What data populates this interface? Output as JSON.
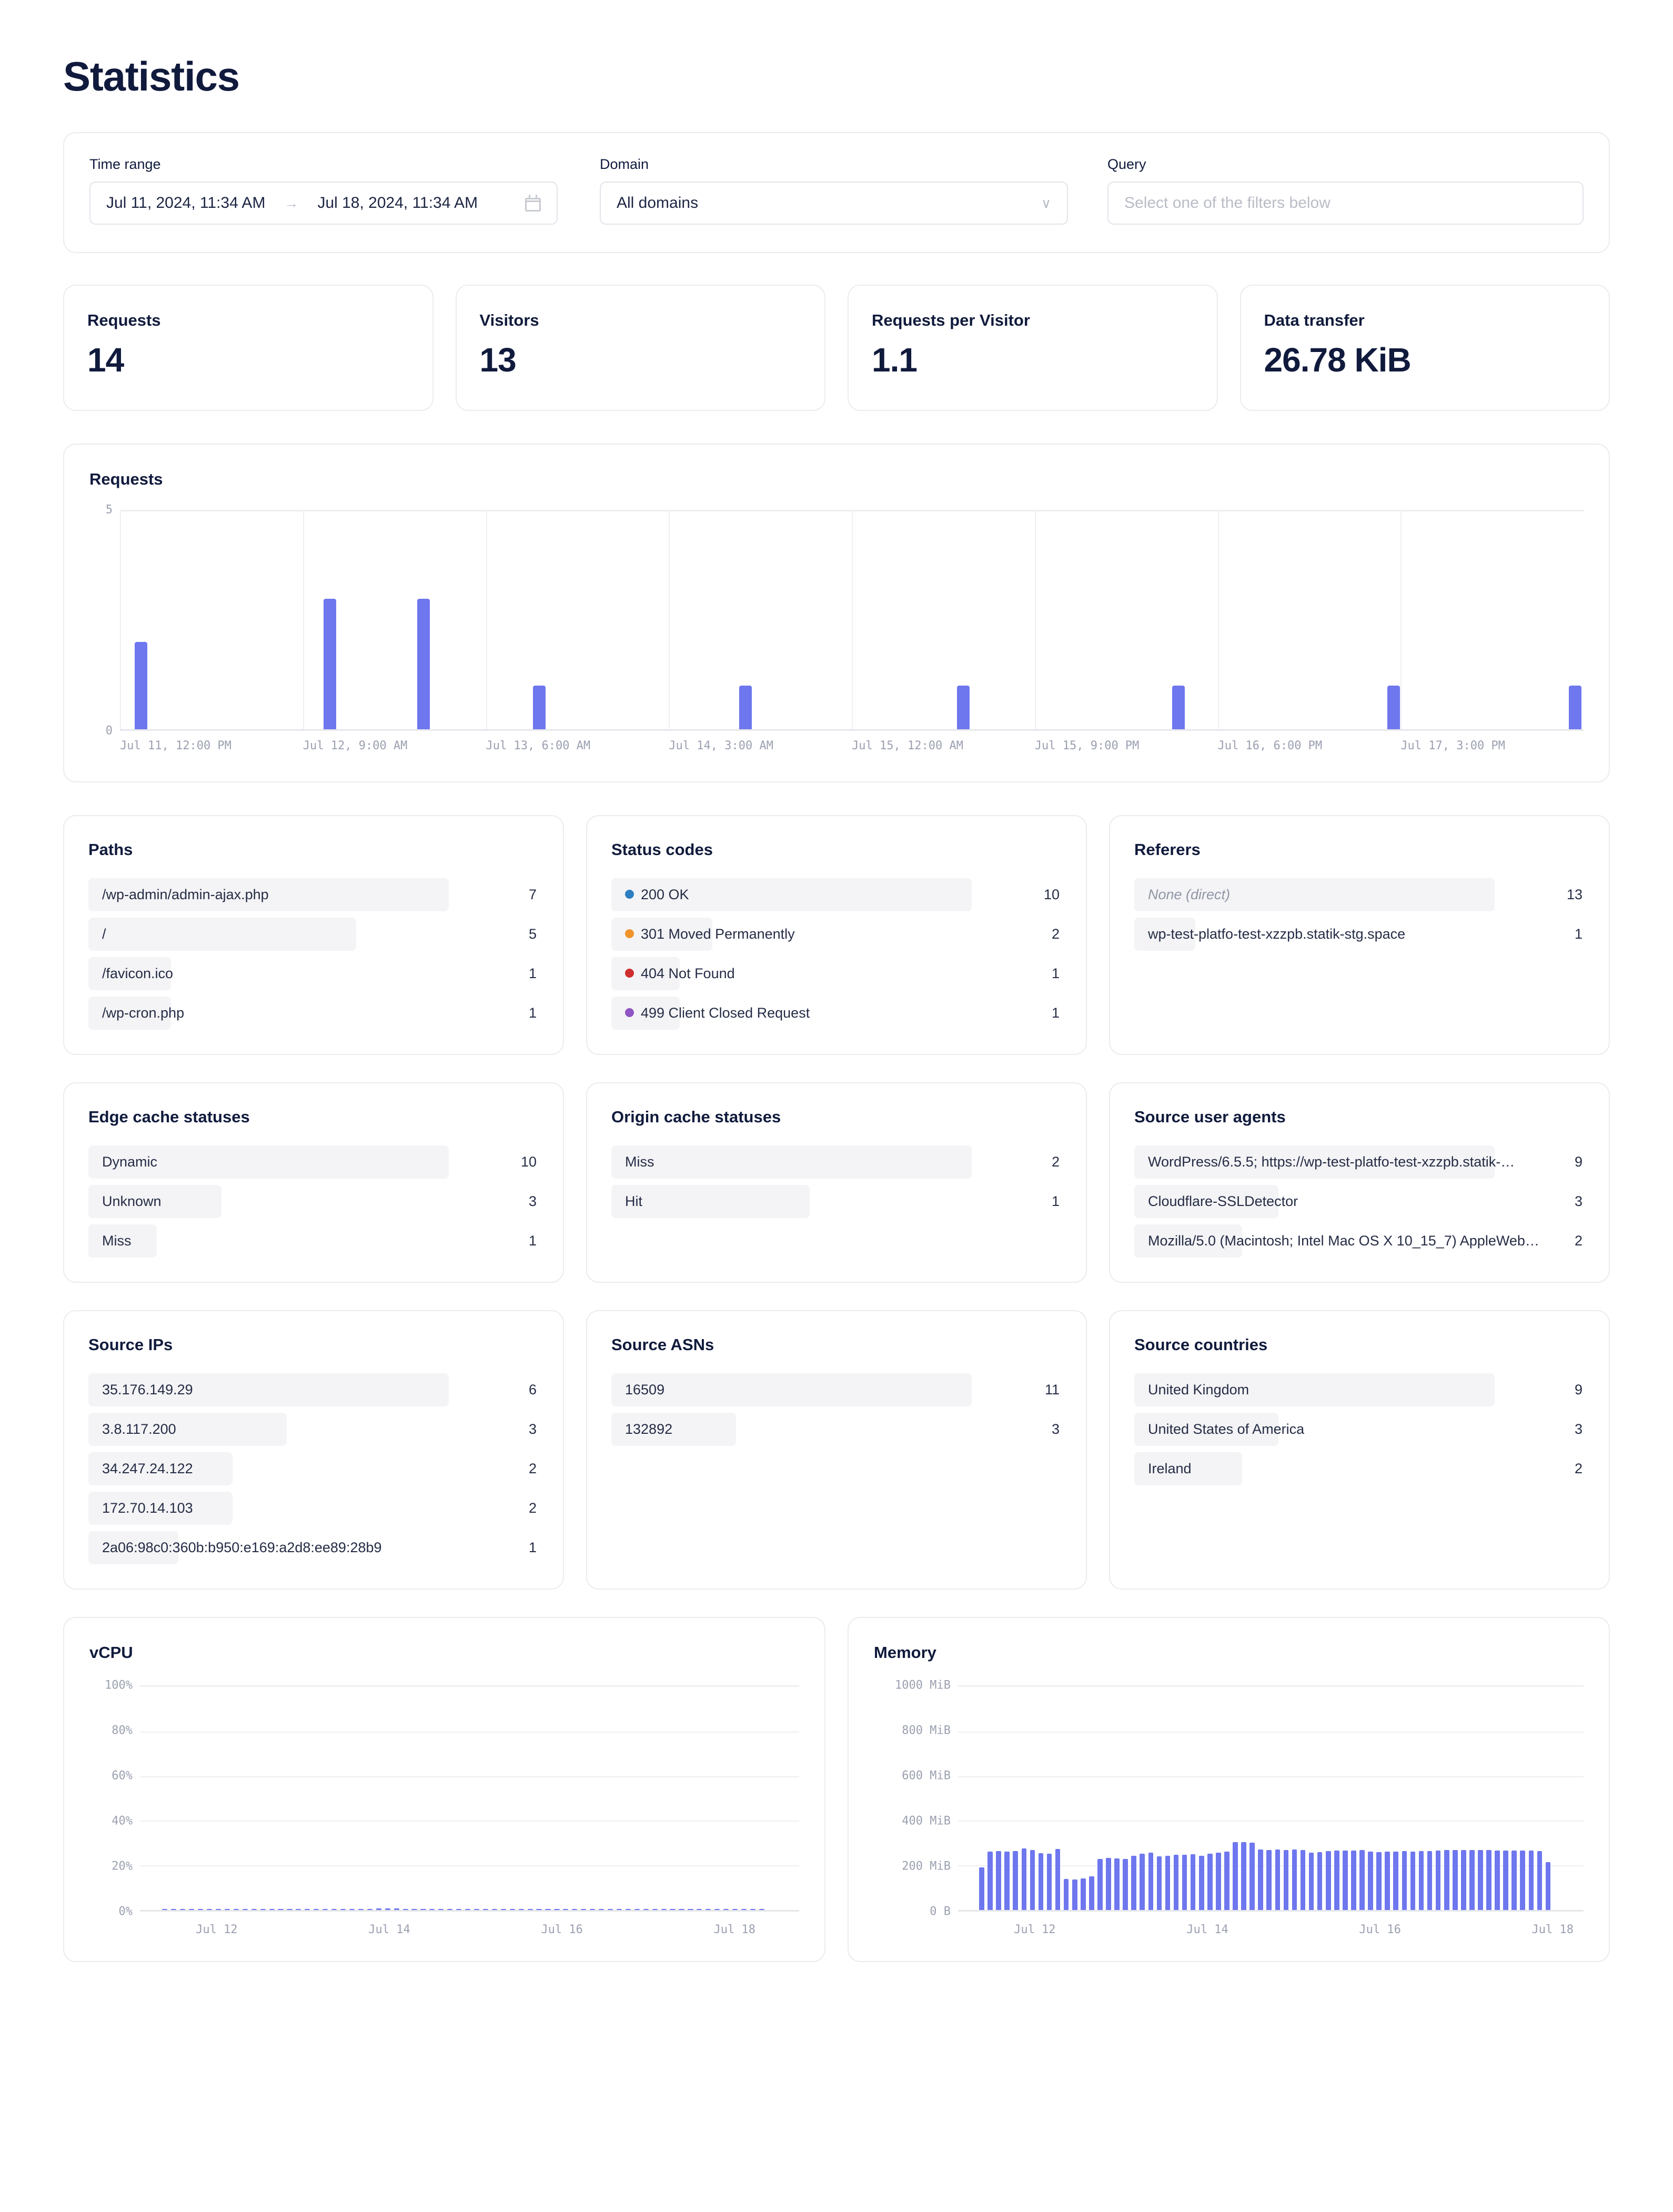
{
  "page": {
    "title": "Statistics"
  },
  "filters": {
    "time_range": {
      "label": "Time range",
      "start": "Jul 11, 2024, 11:34 AM",
      "end": "Jul 18, 2024, 11:34 AM",
      "arrow": "→"
    },
    "domain": {
      "label": "Domain",
      "value": "All domains",
      "chevron": "∨"
    },
    "query": {
      "label": "Query",
      "value": "",
      "placeholder": "Select one of the filters below"
    }
  },
  "kpis": [
    {
      "label": "Requests",
      "value": "14"
    },
    {
      "label": "Visitors",
      "value": "13"
    },
    {
      "label": "Requests per Visitor",
      "value": "1.1"
    },
    {
      "label": "Data transfer",
      "value": "26.78 KiB"
    }
  ],
  "requests_chart": {
    "title": "Requests"
  },
  "panels": {
    "paths": {
      "title": "Paths",
      "rows": [
        {
          "label": "/wp-admin/admin-ajax.php",
          "count": "7"
        },
        {
          "label": "/",
          "count": "5"
        },
        {
          "label": "/favicon.ico",
          "count": "1"
        },
        {
          "label": "/wp-cron.php",
          "count": "1"
        }
      ]
    },
    "status_codes": {
      "title": "Status codes",
      "rows": [
        {
          "label": "200 OK",
          "count": "10",
          "color": "#2d7fc1"
        },
        {
          "label": "301 Moved Permanently",
          "count": "2",
          "color": "#f0932b"
        },
        {
          "label": "404 Not Found",
          "count": "1",
          "color": "#cf2e2e"
        },
        {
          "label": "499 Client Closed Request",
          "count": "1",
          "color": "#8e55c4"
        }
      ]
    },
    "referers": {
      "title": "Referers",
      "rows": [
        {
          "label": "None (direct)",
          "count": "13",
          "muted": true
        },
        {
          "label": "wp-test-platfo-test-xzzpb.statik-stg.space",
          "count": "1"
        }
      ]
    },
    "edge_cache": {
      "title": "Edge cache statuses",
      "rows": [
        {
          "label": "Dynamic",
          "count": "10"
        },
        {
          "label": "Unknown",
          "count": "3"
        },
        {
          "label": "Miss",
          "count": "1"
        }
      ]
    },
    "origin_cache": {
      "title": "Origin cache statuses",
      "rows": [
        {
          "label": "Miss",
          "count": "2"
        },
        {
          "label": "Hit",
          "count": "1"
        }
      ]
    },
    "user_agents": {
      "title": "Source user agents",
      "rows": [
        {
          "label": "WordPress/6.5.5; https://wp-test-platfo-test-xzzpb.statik-…",
          "count": "9"
        },
        {
          "label": "Cloudflare-SSLDetector",
          "count": "3"
        },
        {
          "label": "Mozilla/5.0 (Macintosh; Intel Mac OS X 10_15_7) AppleWeb…",
          "count": "2"
        }
      ]
    },
    "source_ips": {
      "title": "Source IPs",
      "rows": [
        {
          "label": "35.176.149.29",
          "count": "6"
        },
        {
          "label": "3.8.117.200",
          "count": "3"
        },
        {
          "label": "34.247.24.122",
          "count": "2"
        },
        {
          "label": "172.70.14.103",
          "count": "2"
        },
        {
          "label": "2a06:98c0:360b:b950:e169:a2d8:ee89:28b9",
          "count": "1"
        }
      ]
    },
    "source_asns": {
      "title": "Source ASNs",
      "rows": [
        {
          "label": "16509",
          "count": "11"
        },
        {
          "label": "132892",
          "count": "3"
        }
      ]
    },
    "source_countries": {
      "title": "Source countries",
      "rows": [
        {
          "label": "United Kingdom",
          "count": "9"
        },
        {
          "label": "United States of America",
          "count": "3"
        },
        {
          "label": "Ireland",
          "count": "2"
        }
      ]
    }
  },
  "vcpu_chart": {
    "title": "vCPU"
  },
  "memory_chart": {
    "title": "Memory"
  },
  "chart_data": [
    {
      "type": "bar",
      "title": "Requests",
      "xlabel": "",
      "ylabel": "",
      "ylim": [
        0,
        5
      ],
      "yticks": [
        "0",
        "5"
      ],
      "grid": true,
      "accent": "#6e77ee",
      "xticks": [
        "Jul 11, 12:00 PM",
        "Jul 12, 9:00 AM",
        "Jul 13, 6:00 AM",
        "Jul 14, 3:00 AM",
        "Jul 15, 12:00 AM",
        "Jul 15, 9:00 PM",
        "Jul 16, 6:00 PM",
        "Jul 17, 3:00 PM"
      ],
      "points": [
        {
          "x_pct": 1.0,
          "value": 2
        },
        {
          "x_pct": 13.9,
          "value": 3
        },
        {
          "x_pct": 20.3,
          "value": 3
        },
        {
          "x_pct": 28.2,
          "value": 1
        },
        {
          "x_pct": 42.3,
          "value": 1
        },
        {
          "x_pct": 57.2,
          "value": 1
        },
        {
          "x_pct": 71.9,
          "value": 1
        },
        {
          "x_pct": 86.6,
          "value": 1
        },
        {
          "x_pct": 99.0,
          "value": 1
        }
      ]
    },
    {
      "type": "bar",
      "title": "vCPU",
      "xlabel": "",
      "ylabel": "",
      "ylim": [
        0,
        100
      ],
      "yticks": [
        "0%",
        "20%",
        "40%",
        "60%",
        "80%",
        "100%"
      ],
      "xticks": [
        "Jul 12",
        "Jul 14",
        "Jul 16",
        "Jul 18"
      ],
      "grid": true,
      "accent": "#6e77ee",
      "unit": "%",
      "values": [
        0.3,
        0.5,
        0.5,
        0.5,
        0.5,
        0.5,
        0.5,
        0.5,
        0.5,
        0.5,
        0.5,
        0.5,
        0.5,
        0.5,
        0.5,
        0.5,
        0.5,
        0.5,
        0.5,
        0.5,
        0.5,
        0.5,
        0.5,
        0.5,
        0.6,
        0.6,
        0.6,
        0.5,
        0.5,
        0.5,
        0.5,
        0.5,
        0.5,
        0.5,
        0.5,
        0.5,
        0.5,
        0.5,
        0.5,
        0.5,
        0.5,
        0.5,
        0.5,
        0.5,
        0.5,
        0.5,
        0.5,
        0.5,
        0.5,
        0.5,
        0.5,
        0.5,
        0.5,
        0.5,
        0.5,
        0.5,
        0.5,
        0.5,
        0.5,
        0.5,
        0.5,
        0.5,
        0.5,
        0.5,
        0.5,
        0.5,
        0.5,
        0.3
      ]
    },
    {
      "type": "bar",
      "title": "Memory",
      "xlabel": "",
      "ylabel": "",
      "ylim": [
        0,
        1000
      ],
      "yticks": [
        "0 B",
        "200 MiB",
        "400 MiB",
        "600 MiB",
        "800 MiB",
        "1000 MiB"
      ],
      "xticks": [
        "Jul 12",
        "Jul 14",
        "Jul 16",
        "Jul 18"
      ],
      "grid": true,
      "accent": "#6e77ee",
      "unit": "MiB",
      "values": [
        190,
        262,
        265,
        263,
        264,
        276,
        268,
        254,
        252,
        274,
        139,
        138,
        142,
        152,
        229,
        233,
        230,
        228,
        244,
        252,
        256,
        240,
        243,
        248,
        248,
        250,
        244,
        252,
        256,
        262,
        304,
        304,
        303,
        272,
        270,
        271,
        270,
        271,
        268,
        258,
        260,
        264,
        266,
        266,
        266,
        268,
        262,
        260,
        262,
        263,
        264,
        263,
        264,
        264,
        266,
        268,
        268,
        268,
        268,
        268,
        268,
        266,
        266,
        266,
        266,
        266,
        264,
        214
      ]
    }
  ]
}
